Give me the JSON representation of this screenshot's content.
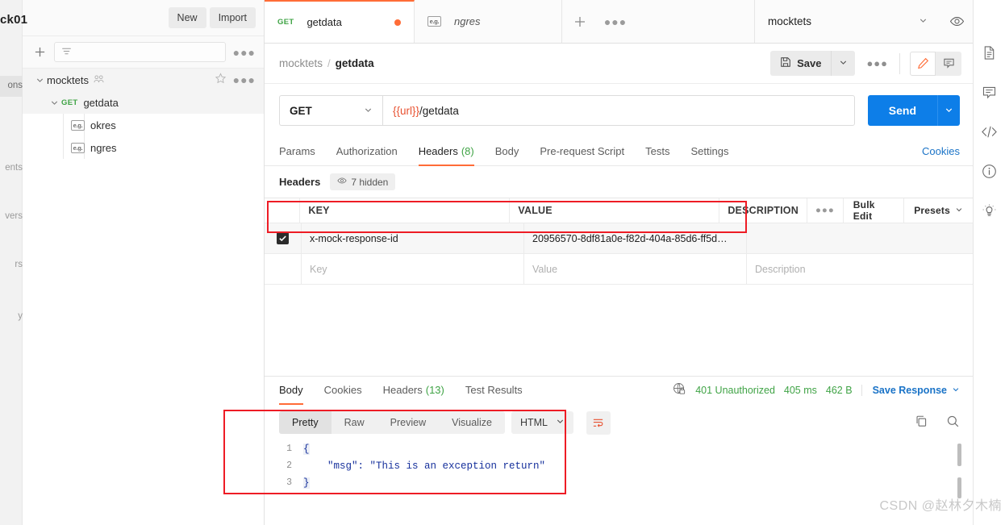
{
  "nav_rail": {
    "items": [
      {
        "label": "ons"
      },
      {
        "label": "ents"
      },
      {
        "label": "vers"
      },
      {
        "label": "rs"
      },
      {
        "label": "y"
      }
    ]
  },
  "sidebar": {
    "workspace_title": "ck01",
    "new_button": "New",
    "import_button": "Import",
    "filter_placeholder": "",
    "more_menu": "●●●",
    "tree": [
      {
        "label": "mocktets",
        "type": "collection"
      },
      {
        "label": "getdata",
        "type": "request",
        "method": "GET"
      },
      {
        "label": "okres",
        "type": "example",
        "icon_text": "e.g."
      },
      {
        "label": "ngres",
        "type": "example",
        "icon_text": "e.g."
      }
    ]
  },
  "tabs": {
    "items": [
      {
        "label": "getdata",
        "method": "GET",
        "active": true,
        "unsaved": true
      },
      {
        "label": "ngres",
        "icon_text": "e.g.",
        "active": false,
        "unsaved": false
      }
    ],
    "add_label": "+",
    "more_label": "●●●",
    "environment": "mocktets"
  },
  "breadcrumb": {
    "collection": "mocktets",
    "separator": "/",
    "request": "getdata",
    "save_label": "Save",
    "more_label": "●●●"
  },
  "request": {
    "method": "GET",
    "url_variable": "{{url}}",
    "url_path": "/getdata",
    "send_label": "Send",
    "tabs": [
      {
        "label": "Params",
        "active": false
      },
      {
        "label": "Authorization",
        "active": false
      },
      {
        "label": "Headers",
        "count": "(8)",
        "active": true
      },
      {
        "label": "Body",
        "active": false
      },
      {
        "label": "Pre-request Script",
        "active": false
      },
      {
        "label": "Tests",
        "active": false
      },
      {
        "label": "Settings",
        "active": false
      }
    ],
    "cookies_link": "Cookies"
  },
  "headers_panel": {
    "title": "Headers",
    "hidden_pill": "7 hidden",
    "columns": {
      "key": "KEY",
      "value": "VALUE",
      "description": "DESCRIPTION"
    },
    "bulk_edit": "Bulk Edit",
    "presets": "Presets",
    "rows": [
      {
        "checked": true,
        "key": "x-mock-response-id",
        "value": "20956570-8df81a0e-f82d-404a-85d6-ff5d…",
        "description": ""
      }
    ],
    "placeholder_row": {
      "key": "Key",
      "value": "Value",
      "description": "Description"
    }
  },
  "response": {
    "tabs": [
      {
        "label": "Body",
        "active": true
      },
      {
        "label": "Cookies",
        "active": false
      },
      {
        "label": "Headers",
        "count": "(13)",
        "active": false
      },
      {
        "label": "Test Results",
        "active": false
      }
    ],
    "status": "401 Unauthorized",
    "time": "405 ms",
    "size": "462 B",
    "save_response": "Save Response",
    "view_tabs": [
      {
        "label": "Pretty",
        "active": true
      },
      {
        "label": "Raw",
        "active": false
      },
      {
        "label": "Preview",
        "active": false
      },
      {
        "label": "Visualize",
        "active": false
      }
    ],
    "format": "HTML",
    "body_lines": [
      {
        "num": "1",
        "text": "{"
      },
      {
        "num": "2",
        "text": "    \"msg\": \"This is an exception return\""
      },
      {
        "num": "3",
        "text": "}"
      }
    ]
  },
  "right_rail": {
    "icons": [
      "document-icon",
      "comment-icon",
      "code-icon",
      "info-icon",
      "lightbulb-icon"
    ]
  },
  "watermark": "CSDN @赵林夕木楠"
}
